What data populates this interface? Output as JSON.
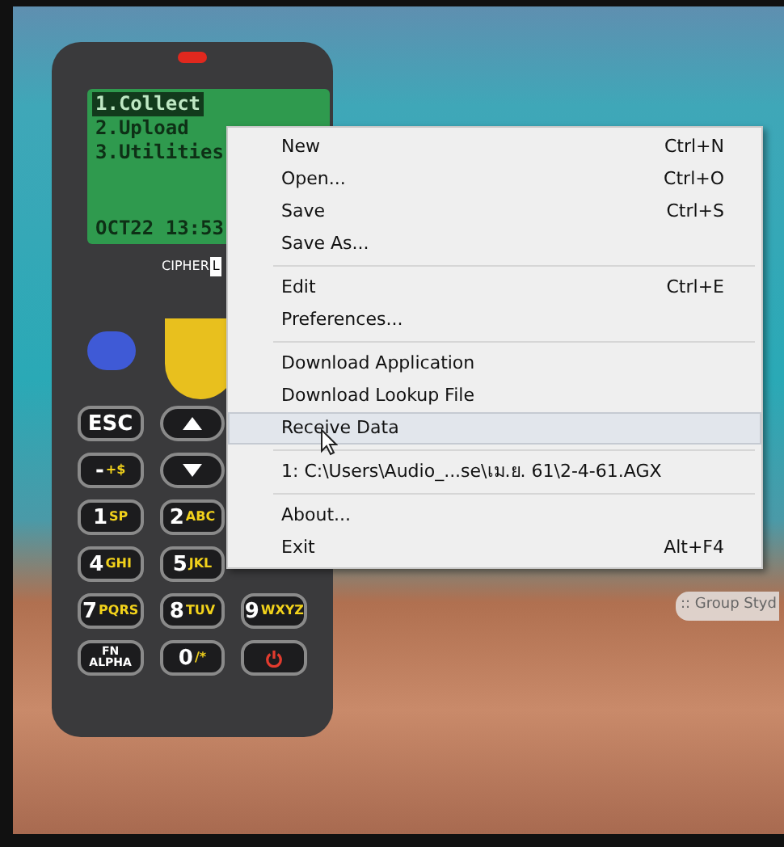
{
  "device": {
    "lcd_lines": [
      {
        "text": "1.Collect",
        "selected": true
      },
      {
        "text": "2.Upload",
        "selected": false
      },
      {
        "text": "3.Utilities",
        "selected": false
      }
    ],
    "lcd_status": "OCT22 13:53",
    "logo": [
      "CIPHER",
      "L"
    ],
    "key_rows": [
      [
        {
          "kind": "text",
          "main": "ESC"
        },
        {
          "kind": "up"
        }
      ],
      [
        {
          "kind": "text",
          "main": "-",
          "sub": "+$"
        },
        {
          "kind": "down"
        }
      ],
      [
        {
          "kind": "text",
          "main": "1",
          "sub": "SP"
        },
        {
          "kind": "text",
          "main": "2",
          "sub": "ABC"
        }
      ],
      [
        {
          "kind": "text",
          "main": "4",
          "sub": "GHI"
        },
        {
          "kind": "text",
          "main": "5",
          "sub": "JKL"
        }
      ],
      [
        {
          "kind": "text",
          "main": "7",
          "sub": "PQRS"
        },
        {
          "kind": "text",
          "main": "8",
          "sub": "TUV"
        },
        {
          "kind": "text",
          "main": "9",
          "sub": "WXYZ"
        }
      ],
      [
        {
          "kind": "stack",
          "main": "FN",
          "sub": "ALPHA"
        },
        {
          "kind": "text",
          "main": "0",
          "sub": "/*"
        },
        {
          "kind": "power"
        }
      ]
    ]
  },
  "menu": {
    "sections": [
      [
        {
          "label": "New",
          "shortcut": "Ctrl+N",
          "selected": false
        },
        {
          "label": "Open...",
          "shortcut": "Ctrl+O",
          "selected": false
        },
        {
          "label": "Save",
          "shortcut": "Ctrl+S",
          "selected": false
        },
        {
          "label": "Save As...",
          "selected": false
        }
      ],
      [
        {
          "label": "Edit",
          "shortcut": "Ctrl+E",
          "selected": false
        },
        {
          "label": "Preferences...",
          "selected": false
        }
      ],
      [
        {
          "label": "Download Application",
          "selected": false
        },
        {
          "label": "Download Lookup File",
          "selected": false
        },
        {
          "label": "Receive Data",
          "selected": true
        }
      ],
      [
        {
          "label": "1:  C:\\Users\\Audio_...se\\เม.ย. 61\\2-4-61.AGX",
          "selected": false
        }
      ],
      [
        {
          "label": "About...",
          "selected": false
        },
        {
          "label": "Exit",
          "shortcut": "Alt+F4",
          "selected": false
        }
      ]
    ]
  },
  "desktop_label": ":: Group Styd"
}
